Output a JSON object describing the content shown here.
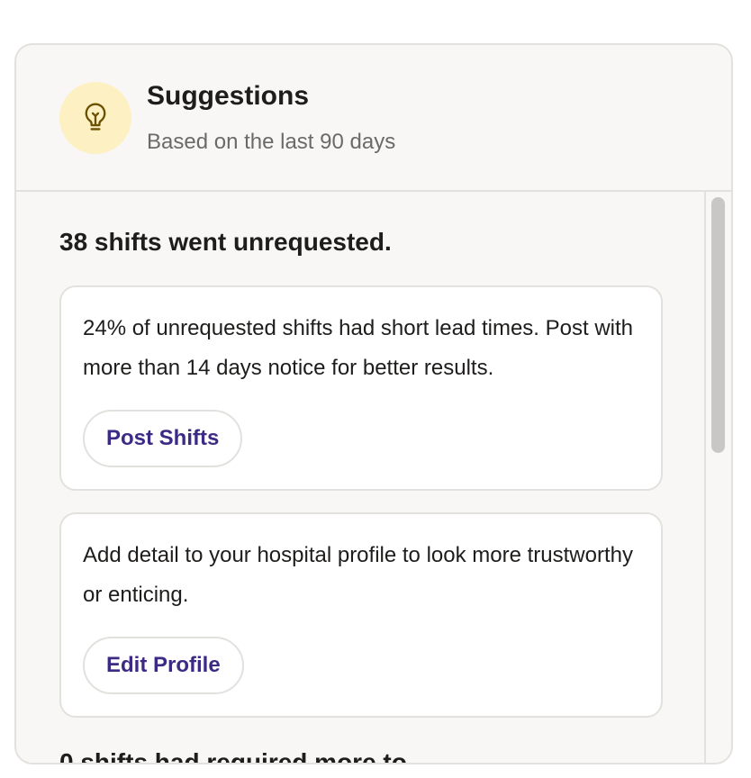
{
  "header": {
    "title": "Suggestions",
    "subtitle": "Based on the last 90 days",
    "icon": "lightbulb-icon"
  },
  "sections": [
    {
      "heading": "38 shifts went unrequested.",
      "cards": [
        {
          "text": "24% of unrequested shifts had short lead times. Post with more than 14 days notice for better results.",
          "button_label": "Post Shifts"
        },
        {
          "text": "Add detail to your hospital profile to look more trustworthy or enticing.",
          "button_label": "Edit Profile"
        }
      ]
    },
    {
      "heading": "0 shifts had required more to"
    }
  ],
  "colors": {
    "accent_text": "#3d2a84",
    "badge_bg": "#fdf0c3",
    "panel_bg": "#f8f7f5",
    "border": "#e3e1de"
  }
}
